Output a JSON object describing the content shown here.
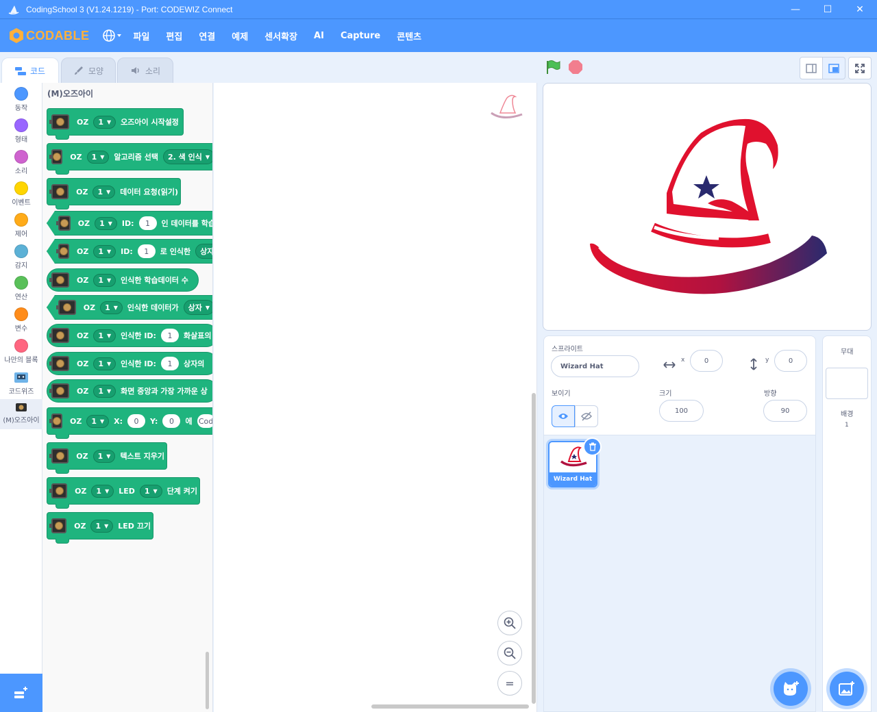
{
  "window": {
    "title": "CodingSchool 3 (V1.24.1219) - Port: CODEWIZ Connect",
    "minimize": "—",
    "maximize": "☐",
    "close": "✕"
  },
  "menu": {
    "logo_text": "CODABLE",
    "items": [
      "파일",
      "편집",
      "연결",
      "예제",
      "센서확장",
      "AI",
      "Capture",
      "콘텐츠"
    ]
  },
  "tabs": {
    "code": "코드",
    "costumes": "모양",
    "sounds": "소리"
  },
  "categories": [
    {
      "label": "동작",
      "color": "#4c97ff"
    },
    {
      "label": "형태",
      "color": "#9966ff"
    },
    {
      "label": "소리",
      "color": "#cf63cf"
    },
    {
      "label": "이벤트",
      "color": "#ffd500"
    },
    {
      "label": "제어",
      "color": "#ffab19"
    },
    {
      "label": "감지",
      "color": "#5cb1d6"
    },
    {
      "label": "연산",
      "color": "#59c059"
    },
    {
      "label": "변수",
      "color": "#ff8c1a"
    },
    {
      "label": "나만의 블록",
      "color": "#ff6680"
    },
    {
      "label": "코드위즈",
      "icon": "codewiz-board-icon"
    },
    {
      "label": "(M)오즈아이",
      "icon": "ozeye-camera-icon"
    }
  ],
  "palette": {
    "title": "(M)오즈아이",
    "oz": "OZ",
    "one": "1",
    "zero": "0",
    "blocks": {
      "b1": "오즈아이 시작설정",
      "b2": "알고리즘 선택",
      "b2_opt": "2. 색 인식",
      "b3": "데이터 요청(읽기)",
      "id_label": "ID:",
      "b4": "인 데이터를 학습",
      "b5": "로 인식한",
      "b5_opt": "상자",
      "b6": "인식한 학습데이터 수",
      "b7": "인식한 데이터가",
      "b7_opt": "상자",
      "b8_pre": "인식한 ID:",
      "b8": "화살표의",
      "b9_pre": "인식한 ID:",
      "b9": "상자의",
      "b10": "화면 중앙과 가장 가까운 상",
      "x_label": "X:",
      "y_label": "Y:",
      "b11": "에",
      "b11_input": "Cod",
      "b12": "텍스트 지우기",
      "b13_led": "LED",
      "b13": "단계 켜기",
      "b14": "LED 끄기"
    }
  },
  "zoom": {
    "in": "+",
    "out": "−",
    "reset": "="
  },
  "sprite": {
    "section_label": "스프라이트",
    "name": "Wizard Hat",
    "x_label": "x",
    "x": "0",
    "y_label": "y",
    "y": "0",
    "show_label": "보이기",
    "size_label": "크기",
    "size": "100",
    "direction_label": "방향",
    "direction": "90",
    "tile_name": "Wizard Hat"
  },
  "stage_panel": {
    "title": "무대",
    "backdrop_label": "배경",
    "backdrop_count": "1"
  },
  "colors": {
    "accent": "#4c97ff",
    "block": "#1fb47e",
    "hat_red": "#e0112e",
    "hat_navy": "#2a2a6e"
  }
}
